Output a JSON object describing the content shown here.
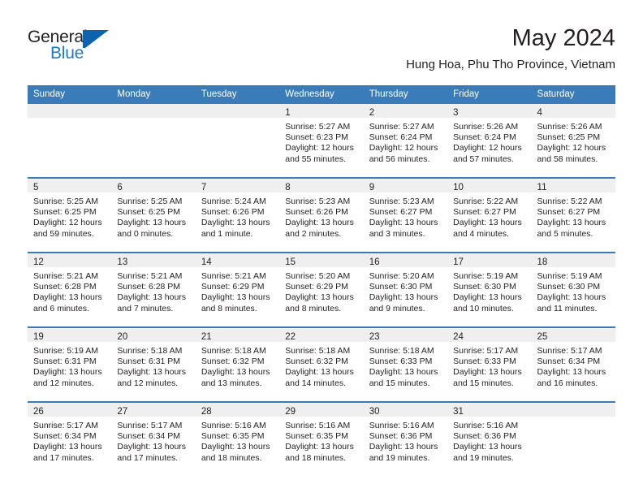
{
  "brand": {
    "name_part1": "General",
    "name_part2": "Blue",
    "mark": "triangle-logo"
  },
  "header": {
    "title": "May 2024",
    "subtitle": "Hung Hoa, Phu Tho Province, Vietnam"
  },
  "calendar": {
    "weekday_headers": [
      "Sunday",
      "Monday",
      "Tuesday",
      "Wednesday",
      "Thursday",
      "Friday",
      "Saturday"
    ],
    "accent_color": "#3a7cba",
    "daynum_band_color": "#efefef",
    "text_color": "#231f20",
    "weeks": [
      [
        {
          "day": "",
          "sunrise": "",
          "sunset": "",
          "daylight_1": "",
          "daylight_2": ""
        },
        {
          "day": "",
          "sunrise": "",
          "sunset": "",
          "daylight_1": "",
          "daylight_2": ""
        },
        {
          "day": "",
          "sunrise": "",
          "sunset": "",
          "daylight_1": "",
          "daylight_2": ""
        },
        {
          "day": "1",
          "sunrise": "Sunrise: 5:27 AM",
          "sunset": "Sunset: 6:23 PM",
          "daylight_1": "Daylight: 12 hours",
          "daylight_2": "and 55 minutes."
        },
        {
          "day": "2",
          "sunrise": "Sunrise: 5:27 AM",
          "sunset": "Sunset: 6:24 PM",
          "daylight_1": "Daylight: 12 hours",
          "daylight_2": "and 56 minutes."
        },
        {
          "day": "3",
          "sunrise": "Sunrise: 5:26 AM",
          "sunset": "Sunset: 6:24 PM",
          "daylight_1": "Daylight: 12 hours",
          "daylight_2": "and 57 minutes."
        },
        {
          "day": "4",
          "sunrise": "Sunrise: 5:26 AM",
          "sunset": "Sunset: 6:25 PM",
          "daylight_1": "Daylight: 12 hours",
          "daylight_2": "and 58 minutes."
        }
      ],
      [
        {
          "day": "5",
          "sunrise": "Sunrise: 5:25 AM",
          "sunset": "Sunset: 6:25 PM",
          "daylight_1": "Daylight: 12 hours",
          "daylight_2": "and 59 minutes."
        },
        {
          "day": "6",
          "sunrise": "Sunrise: 5:25 AM",
          "sunset": "Sunset: 6:25 PM",
          "daylight_1": "Daylight: 13 hours",
          "daylight_2": "and 0 minutes."
        },
        {
          "day": "7",
          "sunrise": "Sunrise: 5:24 AM",
          "sunset": "Sunset: 6:26 PM",
          "daylight_1": "Daylight: 13 hours",
          "daylight_2": "and 1 minute."
        },
        {
          "day": "8",
          "sunrise": "Sunrise: 5:23 AM",
          "sunset": "Sunset: 6:26 PM",
          "daylight_1": "Daylight: 13 hours",
          "daylight_2": "and 2 minutes."
        },
        {
          "day": "9",
          "sunrise": "Sunrise: 5:23 AM",
          "sunset": "Sunset: 6:27 PM",
          "daylight_1": "Daylight: 13 hours",
          "daylight_2": "and 3 minutes."
        },
        {
          "day": "10",
          "sunrise": "Sunrise: 5:22 AM",
          "sunset": "Sunset: 6:27 PM",
          "daylight_1": "Daylight: 13 hours",
          "daylight_2": "and 4 minutes."
        },
        {
          "day": "11",
          "sunrise": "Sunrise: 5:22 AM",
          "sunset": "Sunset: 6:27 PM",
          "daylight_1": "Daylight: 13 hours",
          "daylight_2": "and 5 minutes."
        }
      ],
      [
        {
          "day": "12",
          "sunrise": "Sunrise: 5:21 AM",
          "sunset": "Sunset: 6:28 PM",
          "daylight_1": "Daylight: 13 hours",
          "daylight_2": "and 6 minutes."
        },
        {
          "day": "13",
          "sunrise": "Sunrise: 5:21 AM",
          "sunset": "Sunset: 6:28 PM",
          "daylight_1": "Daylight: 13 hours",
          "daylight_2": "and 7 minutes."
        },
        {
          "day": "14",
          "sunrise": "Sunrise: 5:21 AM",
          "sunset": "Sunset: 6:29 PM",
          "daylight_1": "Daylight: 13 hours",
          "daylight_2": "and 8 minutes."
        },
        {
          "day": "15",
          "sunrise": "Sunrise: 5:20 AM",
          "sunset": "Sunset: 6:29 PM",
          "daylight_1": "Daylight: 13 hours",
          "daylight_2": "and 8 minutes."
        },
        {
          "day": "16",
          "sunrise": "Sunrise: 5:20 AM",
          "sunset": "Sunset: 6:30 PM",
          "daylight_1": "Daylight: 13 hours",
          "daylight_2": "and 9 minutes."
        },
        {
          "day": "17",
          "sunrise": "Sunrise: 5:19 AM",
          "sunset": "Sunset: 6:30 PM",
          "daylight_1": "Daylight: 13 hours",
          "daylight_2": "and 10 minutes."
        },
        {
          "day": "18",
          "sunrise": "Sunrise: 5:19 AM",
          "sunset": "Sunset: 6:30 PM",
          "daylight_1": "Daylight: 13 hours",
          "daylight_2": "and 11 minutes."
        }
      ],
      [
        {
          "day": "19",
          "sunrise": "Sunrise: 5:19 AM",
          "sunset": "Sunset: 6:31 PM",
          "daylight_1": "Daylight: 13 hours",
          "daylight_2": "and 12 minutes."
        },
        {
          "day": "20",
          "sunrise": "Sunrise: 5:18 AM",
          "sunset": "Sunset: 6:31 PM",
          "daylight_1": "Daylight: 13 hours",
          "daylight_2": "and 12 minutes."
        },
        {
          "day": "21",
          "sunrise": "Sunrise: 5:18 AM",
          "sunset": "Sunset: 6:32 PM",
          "daylight_1": "Daylight: 13 hours",
          "daylight_2": "and 13 minutes."
        },
        {
          "day": "22",
          "sunrise": "Sunrise: 5:18 AM",
          "sunset": "Sunset: 6:32 PM",
          "daylight_1": "Daylight: 13 hours",
          "daylight_2": "and 14 minutes."
        },
        {
          "day": "23",
          "sunrise": "Sunrise: 5:18 AM",
          "sunset": "Sunset: 6:33 PM",
          "daylight_1": "Daylight: 13 hours",
          "daylight_2": "and 15 minutes."
        },
        {
          "day": "24",
          "sunrise": "Sunrise: 5:17 AM",
          "sunset": "Sunset: 6:33 PM",
          "daylight_1": "Daylight: 13 hours",
          "daylight_2": "and 15 minutes."
        },
        {
          "day": "25",
          "sunrise": "Sunrise: 5:17 AM",
          "sunset": "Sunset: 6:34 PM",
          "daylight_1": "Daylight: 13 hours",
          "daylight_2": "and 16 minutes."
        }
      ],
      [
        {
          "day": "26",
          "sunrise": "Sunrise: 5:17 AM",
          "sunset": "Sunset: 6:34 PM",
          "daylight_1": "Daylight: 13 hours",
          "daylight_2": "and 17 minutes."
        },
        {
          "day": "27",
          "sunrise": "Sunrise: 5:17 AM",
          "sunset": "Sunset: 6:34 PM",
          "daylight_1": "Daylight: 13 hours",
          "daylight_2": "and 17 minutes."
        },
        {
          "day": "28",
          "sunrise": "Sunrise: 5:16 AM",
          "sunset": "Sunset: 6:35 PM",
          "daylight_1": "Daylight: 13 hours",
          "daylight_2": "and 18 minutes."
        },
        {
          "day": "29",
          "sunrise": "Sunrise: 5:16 AM",
          "sunset": "Sunset: 6:35 PM",
          "daylight_1": "Daylight: 13 hours",
          "daylight_2": "and 18 minutes."
        },
        {
          "day": "30",
          "sunrise": "Sunrise: 5:16 AM",
          "sunset": "Sunset: 6:36 PM",
          "daylight_1": "Daylight: 13 hours",
          "daylight_2": "and 19 minutes."
        },
        {
          "day": "31",
          "sunrise": "Sunrise: 5:16 AM",
          "sunset": "Sunset: 6:36 PM",
          "daylight_1": "Daylight: 13 hours",
          "daylight_2": "and 19 minutes."
        },
        {
          "day": "",
          "sunrise": "",
          "sunset": "",
          "daylight_1": "",
          "daylight_2": ""
        }
      ]
    ]
  }
}
